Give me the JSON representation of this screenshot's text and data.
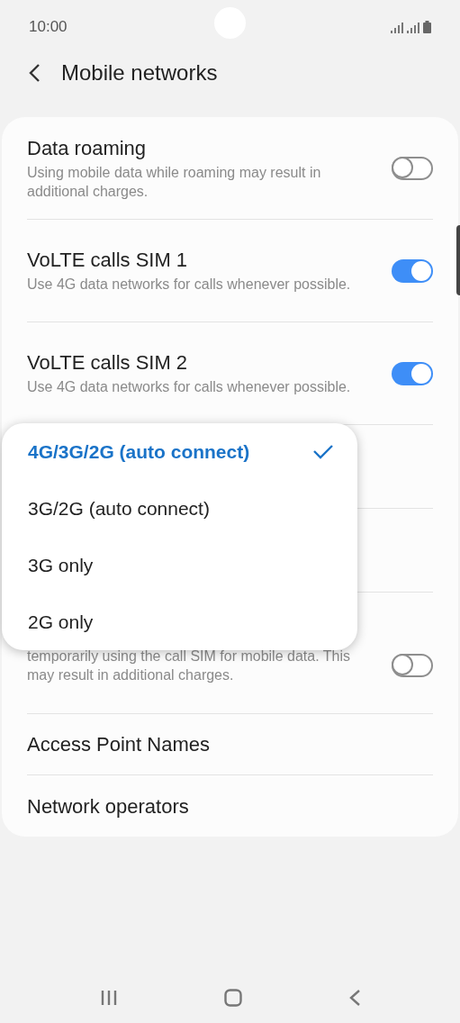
{
  "status_bar": {
    "time": "10:00"
  },
  "header": {
    "title": "Mobile networks"
  },
  "settings": [
    {
      "kind": "toggle",
      "title": "Data roaming",
      "description": "Using mobile data while roaming may result in additional charges.",
      "on": false
    },
    {
      "kind": "toggle",
      "title": "VoLTE calls SIM 1",
      "description": "Use 4G data networks for calls whenever possible.",
      "on": true
    },
    {
      "kind": "toggle",
      "title": "VoLTE calls SIM 2",
      "description": "Use 4G data networks for calls whenever possible.",
      "on": true
    },
    {
      "kind": "covered"
    },
    {
      "kind": "covered"
    },
    {
      "kind": "toggle",
      "description": "temporarily using the call SIM for mobile data. This may result in additional charges.",
      "on": false
    },
    {
      "kind": "link",
      "title": "Access Point Names"
    },
    {
      "kind": "link",
      "title": "Network operators"
    }
  ],
  "popup": {
    "options": [
      {
        "label": "4G/3G/2G (auto connect)",
        "selected": true
      },
      {
        "label": "3G/2G (auto connect)",
        "selected": false
      },
      {
        "label": "3G only",
        "selected": false
      },
      {
        "label": "2G only",
        "selected": false
      }
    ]
  }
}
